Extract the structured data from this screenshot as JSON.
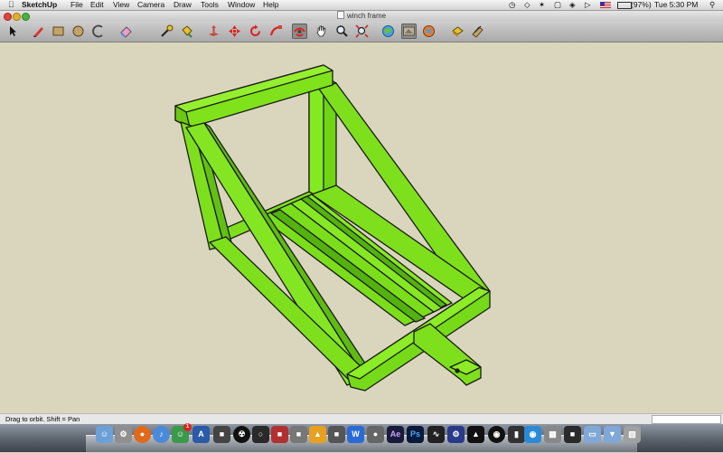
{
  "menubar": {
    "app_name": "SketchUp",
    "menus": [
      "File",
      "Edit",
      "View",
      "Camera",
      "Draw",
      "Tools",
      "Window",
      "Help"
    ],
    "battery": "(97%)",
    "clock": "Tue 5:30 PM"
  },
  "window": {
    "title": "winch frame"
  },
  "toolbar": {
    "icons": [
      "select-icon",
      "pencil-icon",
      "rectangle-icon",
      "circle-icon",
      "arc-icon",
      "eraser-icon",
      "tape-measure-icon",
      "paint-bucket-icon",
      "push-pull-icon",
      "move-icon",
      "rotate-icon",
      "follow-me-icon",
      "orbit-icon",
      "pan-icon",
      "zoom-icon",
      "zoom-extents-icon",
      "get-models-icon",
      "share-model-icon",
      "components-icon",
      "styles-icon",
      "layers-icon"
    ],
    "active_tool": "orbit-icon"
  },
  "model": {
    "color": "#7fe21a",
    "edge_color": "#1a1a1a"
  },
  "status": {
    "hint": "Drag to orbit.  Shift = Pan"
  },
  "dock": {
    "badge_count": "1"
  }
}
